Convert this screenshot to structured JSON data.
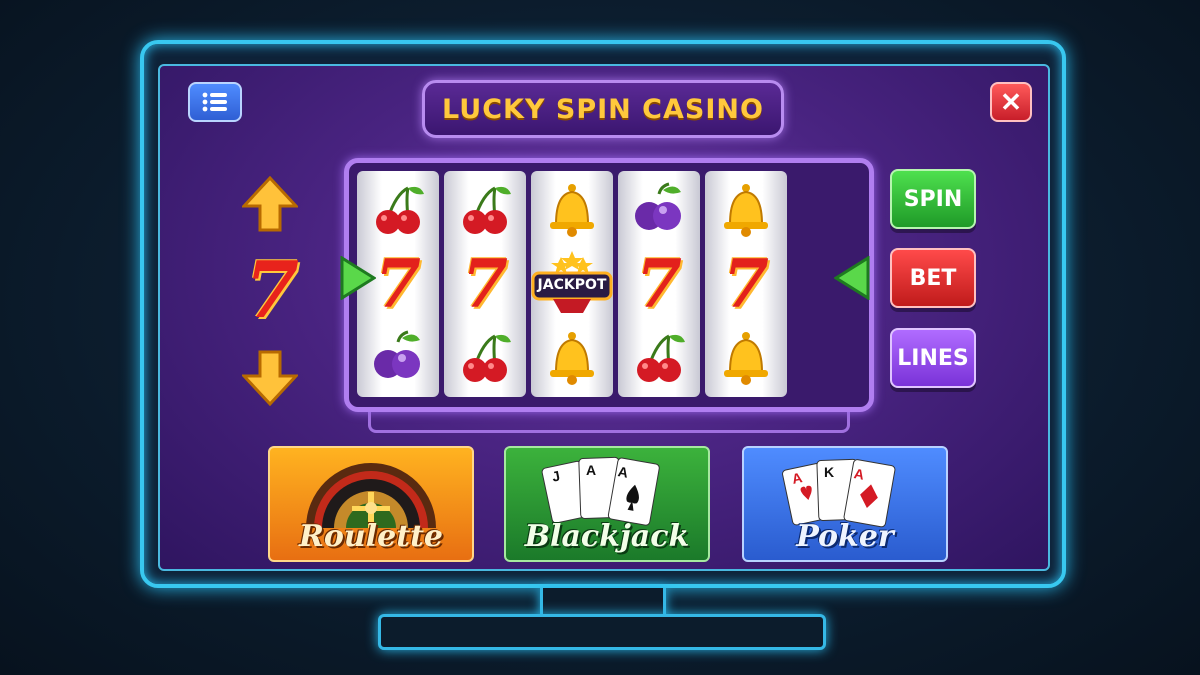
{
  "window": {
    "title": "LUCKY SPIN CASINO",
    "menu_icon": "list-icon",
    "close_label": "✕"
  },
  "side_indicator": {
    "value": "7",
    "up_icon": "arrow-up-icon",
    "down_icon": "arrow-down-icon"
  },
  "reels": [
    {
      "symbols": [
        "cherry",
        "seven",
        "plum"
      ]
    },
    {
      "symbols": [
        "cherry",
        "seven",
        "cherry"
      ]
    },
    {
      "symbols": [
        "bell",
        "jackpot",
        "bell"
      ]
    },
    {
      "symbols": [
        "plum",
        "seven",
        "cherry"
      ]
    },
    {
      "symbols": [
        "bell",
        "seven",
        "bell"
      ]
    }
  ],
  "jackpot_label": "JACKPOT",
  "seven_glyph": "7",
  "controls": {
    "spin": "SPIN",
    "bet": "BET",
    "lines": "LINES"
  },
  "games": [
    {
      "name": "Roulette",
      "icon": "roulette-wheel-icon"
    },
    {
      "name": "Blackjack",
      "icon": "playing-cards-icon"
    },
    {
      "name": "Poker",
      "icon": "playing-cards-icon"
    }
  ],
  "card_faces": {
    "blackjack": [
      "J",
      "A",
      "A"
    ],
    "poker": [
      "A",
      "K",
      "A"
    ]
  },
  "colors": {
    "accent_gold": "#ffc83c",
    "screen_purple": "#4a2482",
    "neon_blue": "#38c8f0"
  }
}
